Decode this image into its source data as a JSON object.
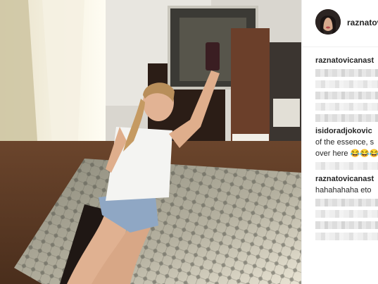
{
  "header": {
    "username": "raznatov"
  },
  "comments": [
    {
      "user": "raznatovicanast",
      "lines": []
    },
    {
      "user": "isidoradjokovic",
      "lines": [
        "of the essence, s",
        "over here 😂😂😂"
      ]
    },
    {
      "user": "raznatovicanast",
      "lines": [
        "hahahahaha eto"
      ]
    }
  ],
  "colors": {
    "text": "#262626",
    "border": "#efefef",
    "blurred": "#d9d9d9"
  }
}
